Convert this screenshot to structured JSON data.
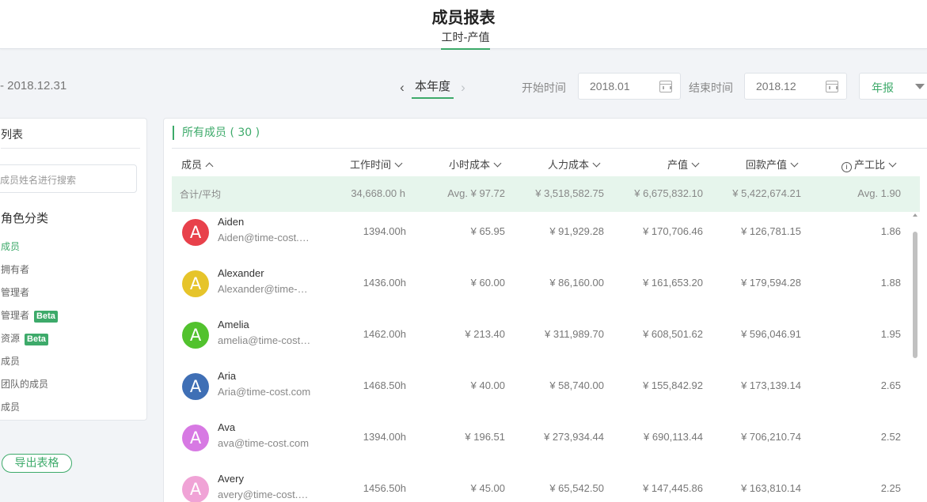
{
  "header": {
    "title": "成员报表",
    "tab": "工时-产值"
  },
  "filters": {
    "range_text": "- 2018.12.31",
    "period_label": "本年度",
    "start_label": "开始时间",
    "start_value": "2018.01",
    "end_label": "结束时间",
    "end_value": "2018.12",
    "report_type": "年报"
  },
  "sidebar": {
    "title": "列表",
    "search_placeholder": "成员姓名进行搜索",
    "section": "角色分类",
    "items": [
      {
        "label": "成员",
        "active": true
      },
      {
        "label": "拥有者"
      },
      {
        "label": "管理者"
      },
      {
        "label": "管理者",
        "beta": "Beta"
      },
      {
        "label": "资源",
        "beta": "Beta"
      },
      {
        "label": "成员"
      },
      {
        "label": "团队的成员"
      },
      {
        "label": "成员"
      }
    ],
    "export_label": "导出表格"
  },
  "table": {
    "title": "所有成员 ( 30 )",
    "headers": {
      "member": "成员",
      "hours": "工作时间",
      "hourly": "小时成本",
      "labor": "人力成本",
      "output": "产值",
      "returned": "回款产值",
      "ratio": "产工比"
    },
    "totals": {
      "label": "合计/平均",
      "hours": "34,668.00 h",
      "hourly": "Avg. ¥ 97.72",
      "labor": "¥ 3,518,582.75",
      "output": "¥ 6,675,832.10",
      "returned": "¥ 5,422,674.21",
      "ratio": "Avg. 1.90"
    },
    "rows": [
      {
        "initial": "A",
        "color": "#e8414b",
        "name": "Aiden",
        "email": "Aiden@time-cost.com",
        "hours": "1394.00h",
        "hourly": "¥ 65.95",
        "labor": "¥ 91,929.28",
        "output": "¥ 170,706.46",
        "returned": "¥ 126,781.15",
        "ratio": "1.86"
      },
      {
        "initial": "A",
        "color": "#e6c42a",
        "name": "Alexander",
        "email": "Alexander@time-cost.com",
        "hours": "1436.00h",
        "hourly": "¥ 60.00",
        "labor": "¥ 86,160.00",
        "output": "¥ 161,653.20",
        "returned": "¥ 179,594.28",
        "ratio": "1.88"
      },
      {
        "initial": "A",
        "color": "#52c22e",
        "name": "Amelia",
        "email": "amelia@time-cost.com",
        "hours": "1462.00h",
        "hourly": "¥ 213.40",
        "labor": "¥ 311,989.70",
        "output": "¥ 608,501.62",
        "returned": "¥ 596,046.91",
        "ratio": "1.95"
      },
      {
        "initial": "A",
        "color": "#3f6fb5",
        "name": "Aria",
        "email": "Aria@time-cost.com",
        "hours": "1468.50h",
        "hourly": "¥ 40.00",
        "labor": "¥ 58,740.00",
        "output": "¥ 155,842.92",
        "returned": "¥ 173,139.14",
        "ratio": "2.65"
      },
      {
        "initial": "A",
        "color": "#d779e3",
        "name": "Ava",
        "email": "ava@time-cost.com",
        "hours": "1394.00h",
        "hourly": "¥ 196.51",
        "labor": "¥ 273,934.44",
        "output": "¥ 690,113.44",
        "returned": "¥ 706,210.74",
        "ratio": "2.52"
      },
      {
        "initial": "A",
        "color": "#f0a3d6",
        "name": "Avery",
        "email": "avery@time-cost.com",
        "hours": "1456.50h",
        "hourly": "¥ 45.00",
        "labor": "¥ 65,542.50",
        "output": "¥ 147,445.86",
        "returned": "¥ 163,810.14",
        "ratio": "2.25"
      }
    ]
  }
}
